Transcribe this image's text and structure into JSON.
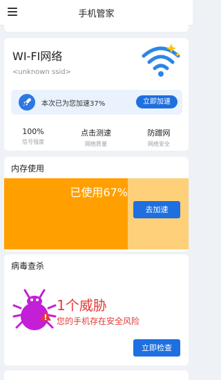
{
  "header": {
    "title": "手机管家"
  },
  "wifi": {
    "title": "WI-FI网络",
    "ssid": "<unknown ssid>",
    "boost_text": "本次已为您加速37%",
    "boost_button": "立即加速",
    "stats": [
      {
        "value": "100%",
        "label": "信号强度"
      },
      {
        "value": "点击测速",
        "label": "网络质量"
      },
      {
        "value": "防蹭网",
        "label": "网络安全"
      }
    ]
  },
  "memory": {
    "title": "内存使用",
    "used_text": "已使用67%",
    "used_fraction": 0.67,
    "button": "去加速"
  },
  "virus": {
    "title": "病毒查杀",
    "threat_count": "1个威胁",
    "threat_desc": "您的手机存在安全风险",
    "button": "立即检查"
  },
  "colors": {
    "accent": "#1e6fe0",
    "memory_used": "#ffa000",
    "memory_free": "#ffd07a",
    "danger": "#e53935",
    "bug": "#c21fd6"
  },
  "icons": {
    "menu": "menu-icon",
    "wifi": "wifi-icon",
    "rocket": "rocket-icon",
    "bug": "bug-icon"
  }
}
